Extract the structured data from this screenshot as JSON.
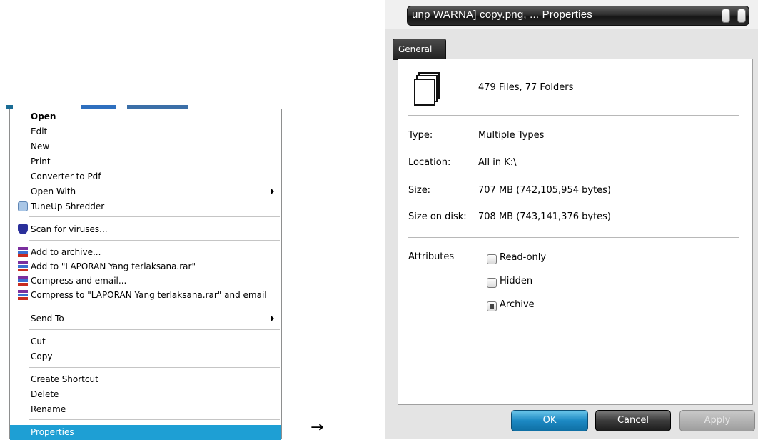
{
  "context_menu": {
    "items": [
      {
        "label": "Open",
        "icon": "",
        "bold": true
      },
      {
        "label": "Edit",
        "icon": ""
      },
      {
        "label": "New",
        "icon": ""
      },
      {
        "label": "Print",
        "icon": ""
      },
      {
        "label": "Converter to Pdf",
        "icon": ""
      },
      {
        "label": "Open With",
        "icon": "",
        "submenu": true
      },
      {
        "label": "TuneUp Shredder",
        "icon": "shredder-icon"
      },
      {
        "label": "Scan for viruses...",
        "icon": "shield-icon"
      },
      {
        "label": "Add to archive...",
        "icon": "winrar-icon"
      },
      {
        "label": "Add to \"LAPORAN Yang terlaksana.rar\"",
        "icon": "winrar-icon"
      },
      {
        "label": "Compress and email...",
        "icon": "winrar-icon"
      },
      {
        "label": "Compress to \"LAPORAN Yang terlaksana.rar\" and email",
        "icon": "winrar-icon"
      },
      {
        "label": "Send To",
        "icon": "",
        "submenu": true
      },
      {
        "label": "Cut",
        "icon": ""
      },
      {
        "label": "Copy",
        "icon": ""
      },
      {
        "label": "Create Shortcut",
        "icon": ""
      },
      {
        "label": "Delete",
        "icon": ""
      },
      {
        "label": "Rename",
        "icon": ""
      },
      {
        "label": "Properties",
        "icon": "",
        "highlighted": true
      }
    ]
  },
  "transition_arrow": "→",
  "properties": {
    "title": "unp WARNA] copy.png, ... Properties",
    "tab": "General",
    "summary": "479 Files, 77 Folders",
    "rows": [
      {
        "key": "Type:",
        "value": "Multiple Types"
      },
      {
        "key": "Location:",
        "value": "All in K:\\"
      },
      {
        "key": "Size:",
        "value": "707 MB (742,105,954 bytes)"
      },
      {
        "key": "Size on disk:",
        "value": "708 MB (743,141,376 bytes)"
      }
    ],
    "attributes_label": "Attributes",
    "attributes": [
      {
        "label": "Read-only",
        "checked": false
      },
      {
        "label": "Hidden",
        "checked": false
      },
      {
        "label": "Archive",
        "checked": true
      }
    ],
    "buttons": {
      "ok": "OK",
      "cancel": "Cancel",
      "apply": "Apply"
    }
  },
  "colors": {
    "highlight": "#1e9fd4",
    "ok_button": "#1c89c3"
  }
}
